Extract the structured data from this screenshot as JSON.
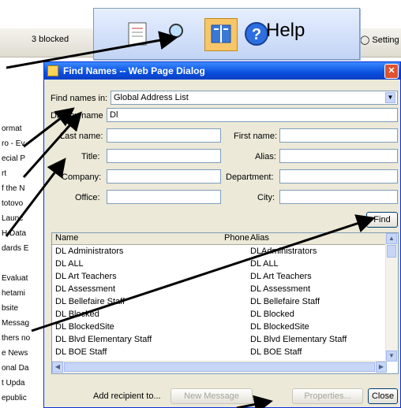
{
  "background": {
    "blocked_text": "3 blocked",
    "settings_text": "Setting",
    "left_items": [
      "ormat",
      "ro - Ev",
      "ecial P",
      "rt",
      "f the N",
      "totovo",
      "Launc",
      "H Data",
      "dards E",
      "",
      "Evaluat",
      "hetami",
      "bsite",
      "Messag",
      "thers no",
      "e News",
      "onal Da",
      "t Upda",
      "epublic"
    ]
  },
  "callout": {
    "help_label": "Help",
    "icons": [
      "new-document-icon",
      "find-icon",
      "address-book-icon",
      "help-icon"
    ]
  },
  "dialog": {
    "title": "Find Names -- Web Page Dialog",
    "find_names_in_label": "Find names in:",
    "find_names_in_value": "Global Address List",
    "display_name_label": "Display name",
    "display_name_value": "Dl",
    "last_name_label": "Last name:",
    "first_name_label": "First name:",
    "title_label": "Title:",
    "alias_label": "Alias:",
    "company_label": "Company:",
    "department_label": "Department:",
    "office_label": "Office:",
    "city_label": "City:",
    "find_button": "Find",
    "columns": {
      "name": "Name",
      "phone": "Phone",
      "alias": "Alias"
    },
    "rows": [
      {
        "name": "DL Administrators",
        "alias": "DLAdministrators"
      },
      {
        "name": "DL ALL",
        "alias": "DL ALL"
      },
      {
        "name": "DL Art Teachers",
        "alias": "DL Art Teachers"
      },
      {
        "name": "DL Assessment",
        "alias": "DL Assessment"
      },
      {
        "name": "DL Bellefaire Staff",
        "alias": "DL Bellefaire Staff"
      },
      {
        "name": "DL Blocked",
        "alias": "DL Blocked"
      },
      {
        "name": "DL BlockedSite",
        "alias": "DL BlockedSite"
      },
      {
        "name": "DL Blvd Elementary Staff",
        "alias": "DL Blvd Elementary Staff"
      },
      {
        "name": "DL BOE Staff",
        "alias": "DL BOE Staff"
      }
    ],
    "add_recipient_label": "Add recipient to...",
    "new_message_button": "New Message",
    "properties_button": "Properties...",
    "close_button": "Close"
  }
}
